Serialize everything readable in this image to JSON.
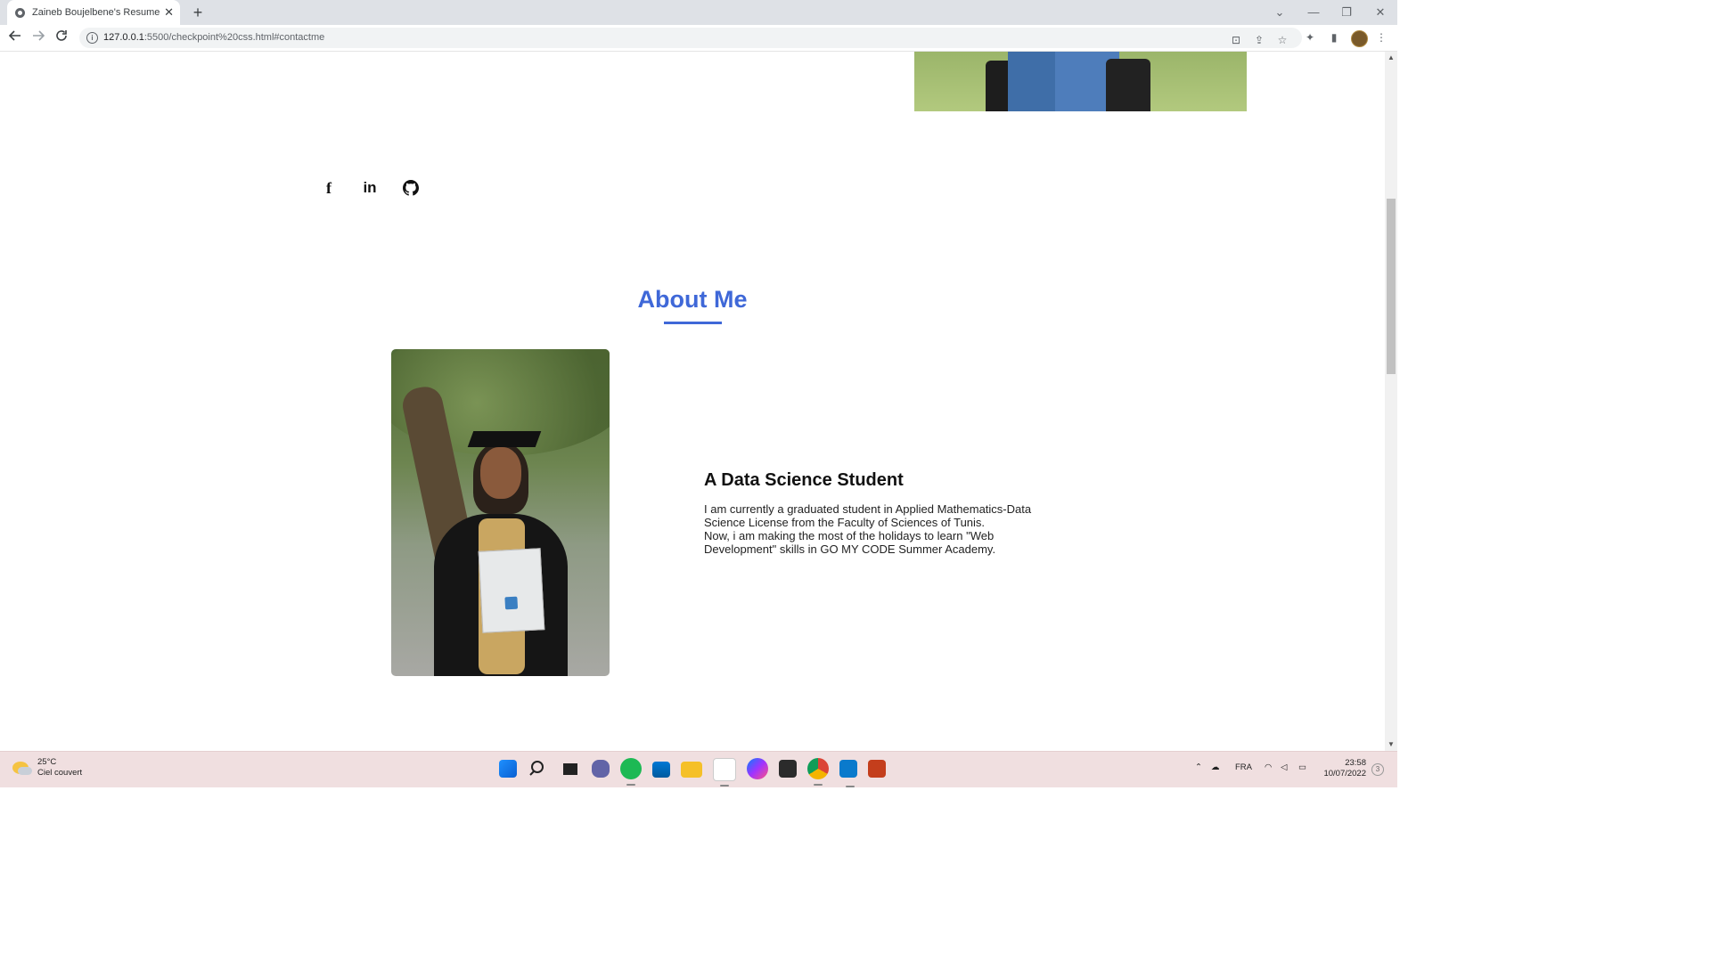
{
  "browser": {
    "tab_title": "Zaineb Boujelbene's Resume",
    "close_glyph": "✕",
    "newtab_glyph": "+",
    "url_host": "127.0.0.1",
    "url_path": ":5500/checkpoint%20css.html#contactme",
    "window_controls": {
      "dropdown": "⌄",
      "minimize": "—",
      "restore": "❐",
      "close": "✕"
    }
  },
  "page": {
    "about_title": "About Me",
    "subtitle": "A Data Science Student",
    "paragraph_1": "I am currently a graduated student in Applied Mathematics-Data Science License from the Faculty of Sciences of Tunis.",
    "paragraph_2": "Now, i am making the most of the holidays to learn \"Web Development\" skills in GO MY CODE Summer Academy.",
    "social": {
      "facebook": "f",
      "linkedin": "in"
    },
    "accent_color": "#3f68d8"
  },
  "taskbar": {
    "temperature": "25°C",
    "weather": "Ciel couvert",
    "language": "FRA",
    "time": "23:58",
    "date": "10/07/2022",
    "notification_count": "3"
  }
}
